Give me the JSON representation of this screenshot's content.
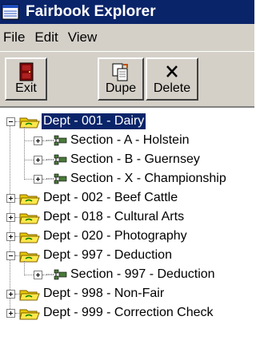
{
  "window": {
    "title": "Fairbook Explorer"
  },
  "menu": {
    "items": [
      "File",
      "Edit",
      "View"
    ]
  },
  "toolbar": {
    "exit_label": "Exit",
    "dupe_label": "Dupe",
    "delete_label": "Delete"
  },
  "tree": {
    "nodes": [
      {
        "label": "Dept - 001 - Dairy",
        "type": "dept",
        "expanded": true,
        "selected": true
      },
      {
        "label": "Section - A - Holstein",
        "type": "section",
        "expanded": false
      },
      {
        "label": "Section - B - Guernsey",
        "type": "section",
        "expanded": false
      },
      {
        "label": "Section - X - Championship",
        "type": "section",
        "expanded": false
      },
      {
        "label": "Dept - 002 - Beef Cattle",
        "type": "dept",
        "expanded": false
      },
      {
        "label": "Dept - 018 - Cultural Arts",
        "type": "dept",
        "expanded": false
      },
      {
        "label": "Dept - 020 - Photography",
        "type": "dept",
        "expanded": false
      },
      {
        "label": "Dept - 997 - Deduction",
        "type": "dept",
        "expanded": true
      },
      {
        "label": "Section - 997 - Deduction",
        "type": "section",
        "expanded": false
      },
      {
        "label": "Dept - 998 - Non-Fair",
        "type": "dept",
        "expanded": false
      },
      {
        "label": "Dept - 999 - Correction Check",
        "type": "dept",
        "expanded": false
      }
    ]
  },
  "colors": {
    "titlebar": "#0a246a",
    "chrome": "#d4d0c8",
    "selection": "#0a246a"
  }
}
